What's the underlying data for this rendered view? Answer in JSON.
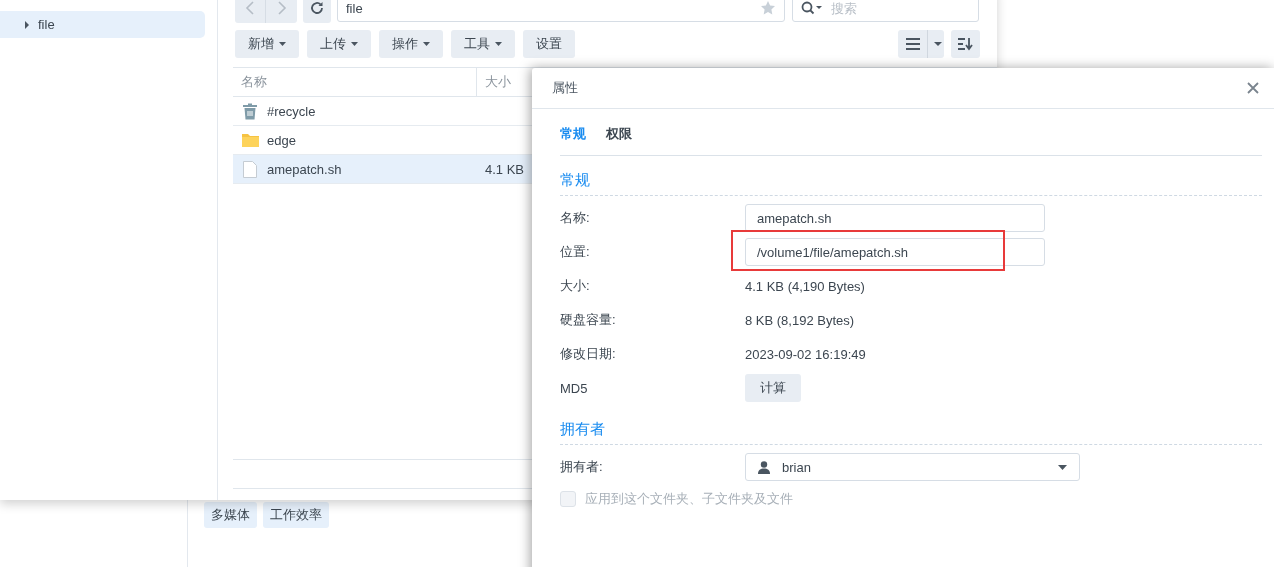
{
  "background": {
    "tags": [
      {
        "label": "多媒体"
      },
      {
        "label": "工作效率"
      }
    ]
  },
  "file_station": {
    "sidebar": {
      "items": [
        {
          "label": "file",
          "selected": true,
          "expanded": false
        }
      ]
    },
    "path": "file",
    "search": {
      "placeholder": "搜索"
    },
    "toolbar": [
      {
        "label": "新增",
        "kind": "menu"
      },
      {
        "label": "上传",
        "kind": "menu"
      },
      {
        "label": "操作",
        "kind": "menu"
      },
      {
        "label": "工具",
        "kind": "menu"
      },
      {
        "label": "设置",
        "kind": "plain"
      }
    ],
    "table": {
      "columns": [
        "名称",
        "大小"
      ],
      "rows": [
        {
          "name": "#recycle",
          "kind": "recycle",
          "selected": false
        },
        {
          "name": "edge",
          "kind": "folder",
          "selected": false
        },
        {
          "name": "amepatch.sh",
          "kind": "file",
          "size": "4.1 KB",
          "selected": true
        }
      ]
    }
  },
  "dialog": {
    "title": "属性",
    "tabs": [
      {
        "label": "常规",
        "selected": true
      },
      {
        "label": "权限",
        "selected": false
      }
    ],
    "sections": [
      {
        "heading": "常规",
        "rows": [
          {
            "label": "名称:",
            "kind": "field",
            "value": "amepatch.sh"
          },
          {
            "label": "位置:",
            "kind": "field",
            "value": "/volume1/file/amepatch.sh",
            "highlighted": true
          },
          {
            "label": "大小:",
            "kind": "text",
            "value": "4.1 KB (4,190 Bytes)"
          },
          {
            "label": "硬盘容量:",
            "kind": "text",
            "value": "8 KB (8,192 Bytes)"
          },
          {
            "label": "修改日期:",
            "kind": "text",
            "value": "2023-09-02 16:19:49"
          },
          {
            "label": "MD5",
            "kind": "button",
            "value": "计算"
          }
        ]
      },
      {
        "heading": "拥有者",
        "rows": [
          {
            "label": "拥有者:",
            "kind": "select",
            "value": "brian"
          }
        ]
      }
    ],
    "apply_checkbox": {
      "label": "应用到这个文件夹、子文件夹及文件",
      "checked": false,
      "disabled": true
    }
  }
}
